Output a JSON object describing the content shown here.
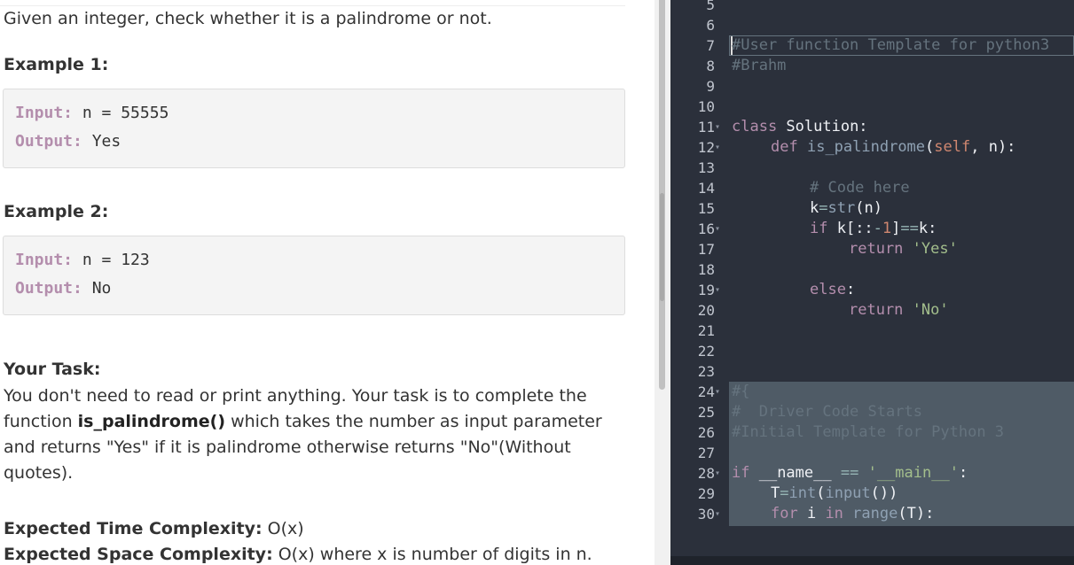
{
  "problem": {
    "intro": "Given an integer, check whether it is a palindrome or not.",
    "example1": {
      "heading": "Example 1:",
      "input_label": "Input:",
      "input_value": " n = 55555",
      "output_label": "Output:",
      "output_value": " Yes"
    },
    "example2": {
      "heading": "Example 2:",
      "input_label": "Input:",
      "input_value": " n = 123",
      "output_label": "Output:",
      "output_value": " No"
    },
    "task": {
      "heading": "Your Task:",
      "text_before": "You don't need to read or print anything. Your task is to complete the function ",
      "function_name": "is_palindrome()",
      "text_after": " which takes the number as input parameter and returns \"Yes\" if it is palindrome otherwise returns \"No\"(Without quotes)."
    },
    "time_complexity": {
      "label": "Expected Time Complexity:",
      "value": " O(x)"
    },
    "space_complexity": {
      "label": "Expected Space Complexity:",
      "value": " O(x) where x is number of digits in n."
    }
  },
  "editor": {
    "line_numbers": [
      "5",
      "6",
      "7",
      "8",
      "9",
      "10",
      "11",
      "12",
      "13",
      "14",
      "15",
      "16",
      "17",
      "18",
      "19",
      "20",
      "21",
      "22",
      "23",
      "24",
      "25",
      "26",
      "27",
      "28",
      "29",
      "30"
    ],
    "code": {
      "l7": "#User function Template for python3",
      "l8": "#Brahm",
      "l11_kw": "class",
      "l11_rest": " Solution:",
      "l12_kw": "def",
      "l12_name": "is_palindrome",
      "l12_open": "(",
      "l12_self": "self",
      "l12_rest": ", n):",
      "l14": "# Code here",
      "l15_k": "k",
      "l15_eq": "=",
      "l15_fn": "str",
      "l15_rest": "(n)",
      "l16_kw": "if",
      "l16_a": " k[::",
      "l16_minus": "-",
      "l16_num": "1",
      "l16_b": "]",
      "l16_eq": "==",
      "l16_c": "k:",
      "l17_kw": "return",
      "l17_str": "'Yes'",
      "l19_kw": "else",
      "l19_rest": ":",
      "l20_kw": "return",
      "l20_str": "'No'",
      "l24": "#{",
      "l25": "#  Driver Code Starts",
      "l26": "#Initial Template for Python 3",
      "l28_kw": "if",
      "l28_name": " __name__ ",
      "l28_eq": "==",
      "l28_str": "'__main__'",
      "l28_rest": ":",
      "l29_t": "T",
      "l29_eq": "=",
      "l29_int": "int",
      "l29_open": "(",
      "l29_input": "input",
      "l29_rest": "())",
      "l30_for": "for",
      "l30_i": " i ",
      "l30_in": "in",
      "l30_range": "range",
      "l30_rest": "(T):"
    }
  }
}
